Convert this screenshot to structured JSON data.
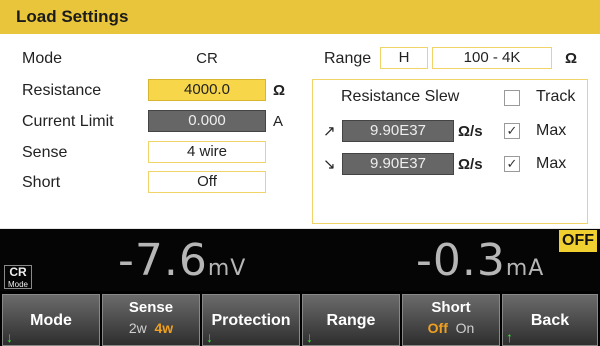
{
  "header": {
    "title": "Load Settings"
  },
  "settings": {
    "mode_label": "Mode",
    "mode_value": "CR",
    "resistance_label": "Resistance",
    "resistance_value": "4000.0",
    "resistance_unit": "Ω",
    "current_limit_label": "Current Limit",
    "current_limit_value": "0.000",
    "current_limit_unit": "A",
    "sense_label": "Sense",
    "sense_value": "4 wire",
    "short_label": "Short",
    "short_value": "Off"
  },
  "range": {
    "label": "Range",
    "level": "H",
    "span": "100 - 4K",
    "unit": "Ω"
  },
  "slew": {
    "title": "Resistance Slew",
    "track_label": "Track",
    "track_checked": false,
    "rise_icon": "arrow-up-right-icon",
    "rise_symbol": "↗",
    "rise_value": "9.90E37",
    "fall_icon": "arrow-down-right-icon",
    "fall_symbol": "↘",
    "fall_value": "9.90E37",
    "unit": "Ω/s",
    "max_label": "Max",
    "rise_max_checked": true,
    "fall_max_checked": true,
    "check_mark": "✓"
  },
  "measurement": {
    "mode_tag": "CR",
    "mode_tag_sub": "Mode",
    "voltage_value": "-7.6",
    "voltage_unit": "mV",
    "current_value": "-0.3",
    "current_unit": "mA",
    "output_state": "OFF",
    "output_state_color": "#f0d030"
  },
  "softkeys": {
    "mode": "Mode",
    "sense": "Sense",
    "sense_opt_2w": "2w",
    "sense_opt_4w": "4w",
    "protection": "Protection",
    "range": "Range",
    "short": "Short",
    "short_opt_off": "Off",
    "short_opt_on": "On",
    "back": "Back",
    "submenu_icon": "arrow-down-icon",
    "submenu_symbol": "↓",
    "back_icon": "arrow-up-icon",
    "back_symbol": "↑"
  },
  "colors": {
    "accent": "#e8c53a",
    "highlight_field": "#f7d64a",
    "selected_option": "#f0a020",
    "submenu_arrow": "#35e035"
  }
}
